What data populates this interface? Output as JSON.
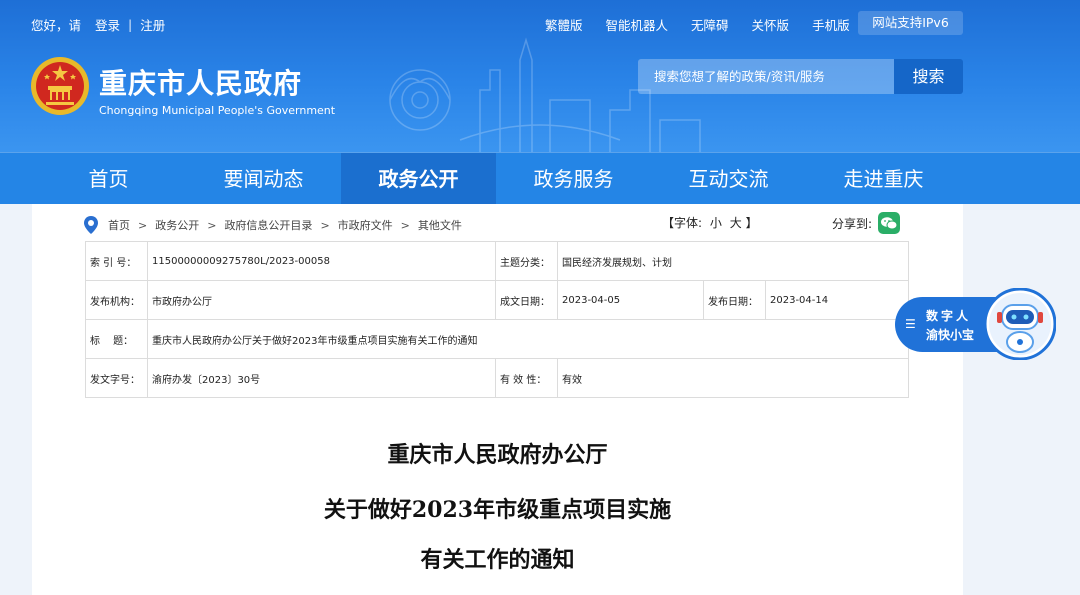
{
  "topbar": {
    "greeting": "您好，请",
    "login": "登录",
    "sep": "|",
    "register": "注册",
    "links": [
      "繁體版",
      "智能机器人",
      "无障碍",
      "关怀版",
      "手机版"
    ],
    "ipv6": "网站支持IPv6"
  },
  "site": {
    "title": "重庆市人民政府",
    "subtitle": "Chongqing Municipal People's Government"
  },
  "search": {
    "placeholder": "搜索您想了解的政策/资讯/服务",
    "button": "搜索"
  },
  "nav": {
    "items": [
      "首页",
      "要闻动态",
      "政务公开",
      "政务服务",
      "互动交流",
      "走进重庆"
    ],
    "active_index": 2
  },
  "breadcrumb": {
    "items": [
      "首页",
      "政务公开",
      "政府信息公开目录",
      "市政府文件",
      "其他文件"
    ],
    "sep": ">"
  },
  "fontsize": {
    "open": "【字体:",
    "small": "小",
    "large": "大",
    "close": "】"
  },
  "share": {
    "label": "分享到:"
  },
  "meta": {
    "index_label": "索 引 号：",
    "index_value": "11500000009275780L/2023-00058",
    "topic_label": "主题分类：",
    "topic_value": "国民经济发展规划、计划",
    "org_label": "发布机构：",
    "org_value": "市政府办公厅",
    "written_label": "成文日期：",
    "written_value": "2023-04-05",
    "published_label": "发布日期：",
    "published_value": "2023-04-14",
    "title_label": "标　 题：",
    "title_value": "重庆市人民政府办公厅关于做好2023年市级重点项目实施有关工作的通知",
    "docno_label": "发文字号：",
    "docno_value": "渝府办发〔2023〕30号",
    "validity_label": "有 效 性：",
    "validity_value": "有效"
  },
  "document": {
    "line1": "重庆市人民政府办公厅",
    "line2": "关于做好2023年市级重点项目实施",
    "line3": "有关工作的通知"
  },
  "assistant": {
    "line1": "数字人",
    "line2": "渝快小宝"
  },
  "colors": {
    "header_blue": "#2a84e8",
    "nav_blue": "#2485e6",
    "nav_active": "#1b6fcf",
    "wechat_green": "#2aae67"
  }
}
